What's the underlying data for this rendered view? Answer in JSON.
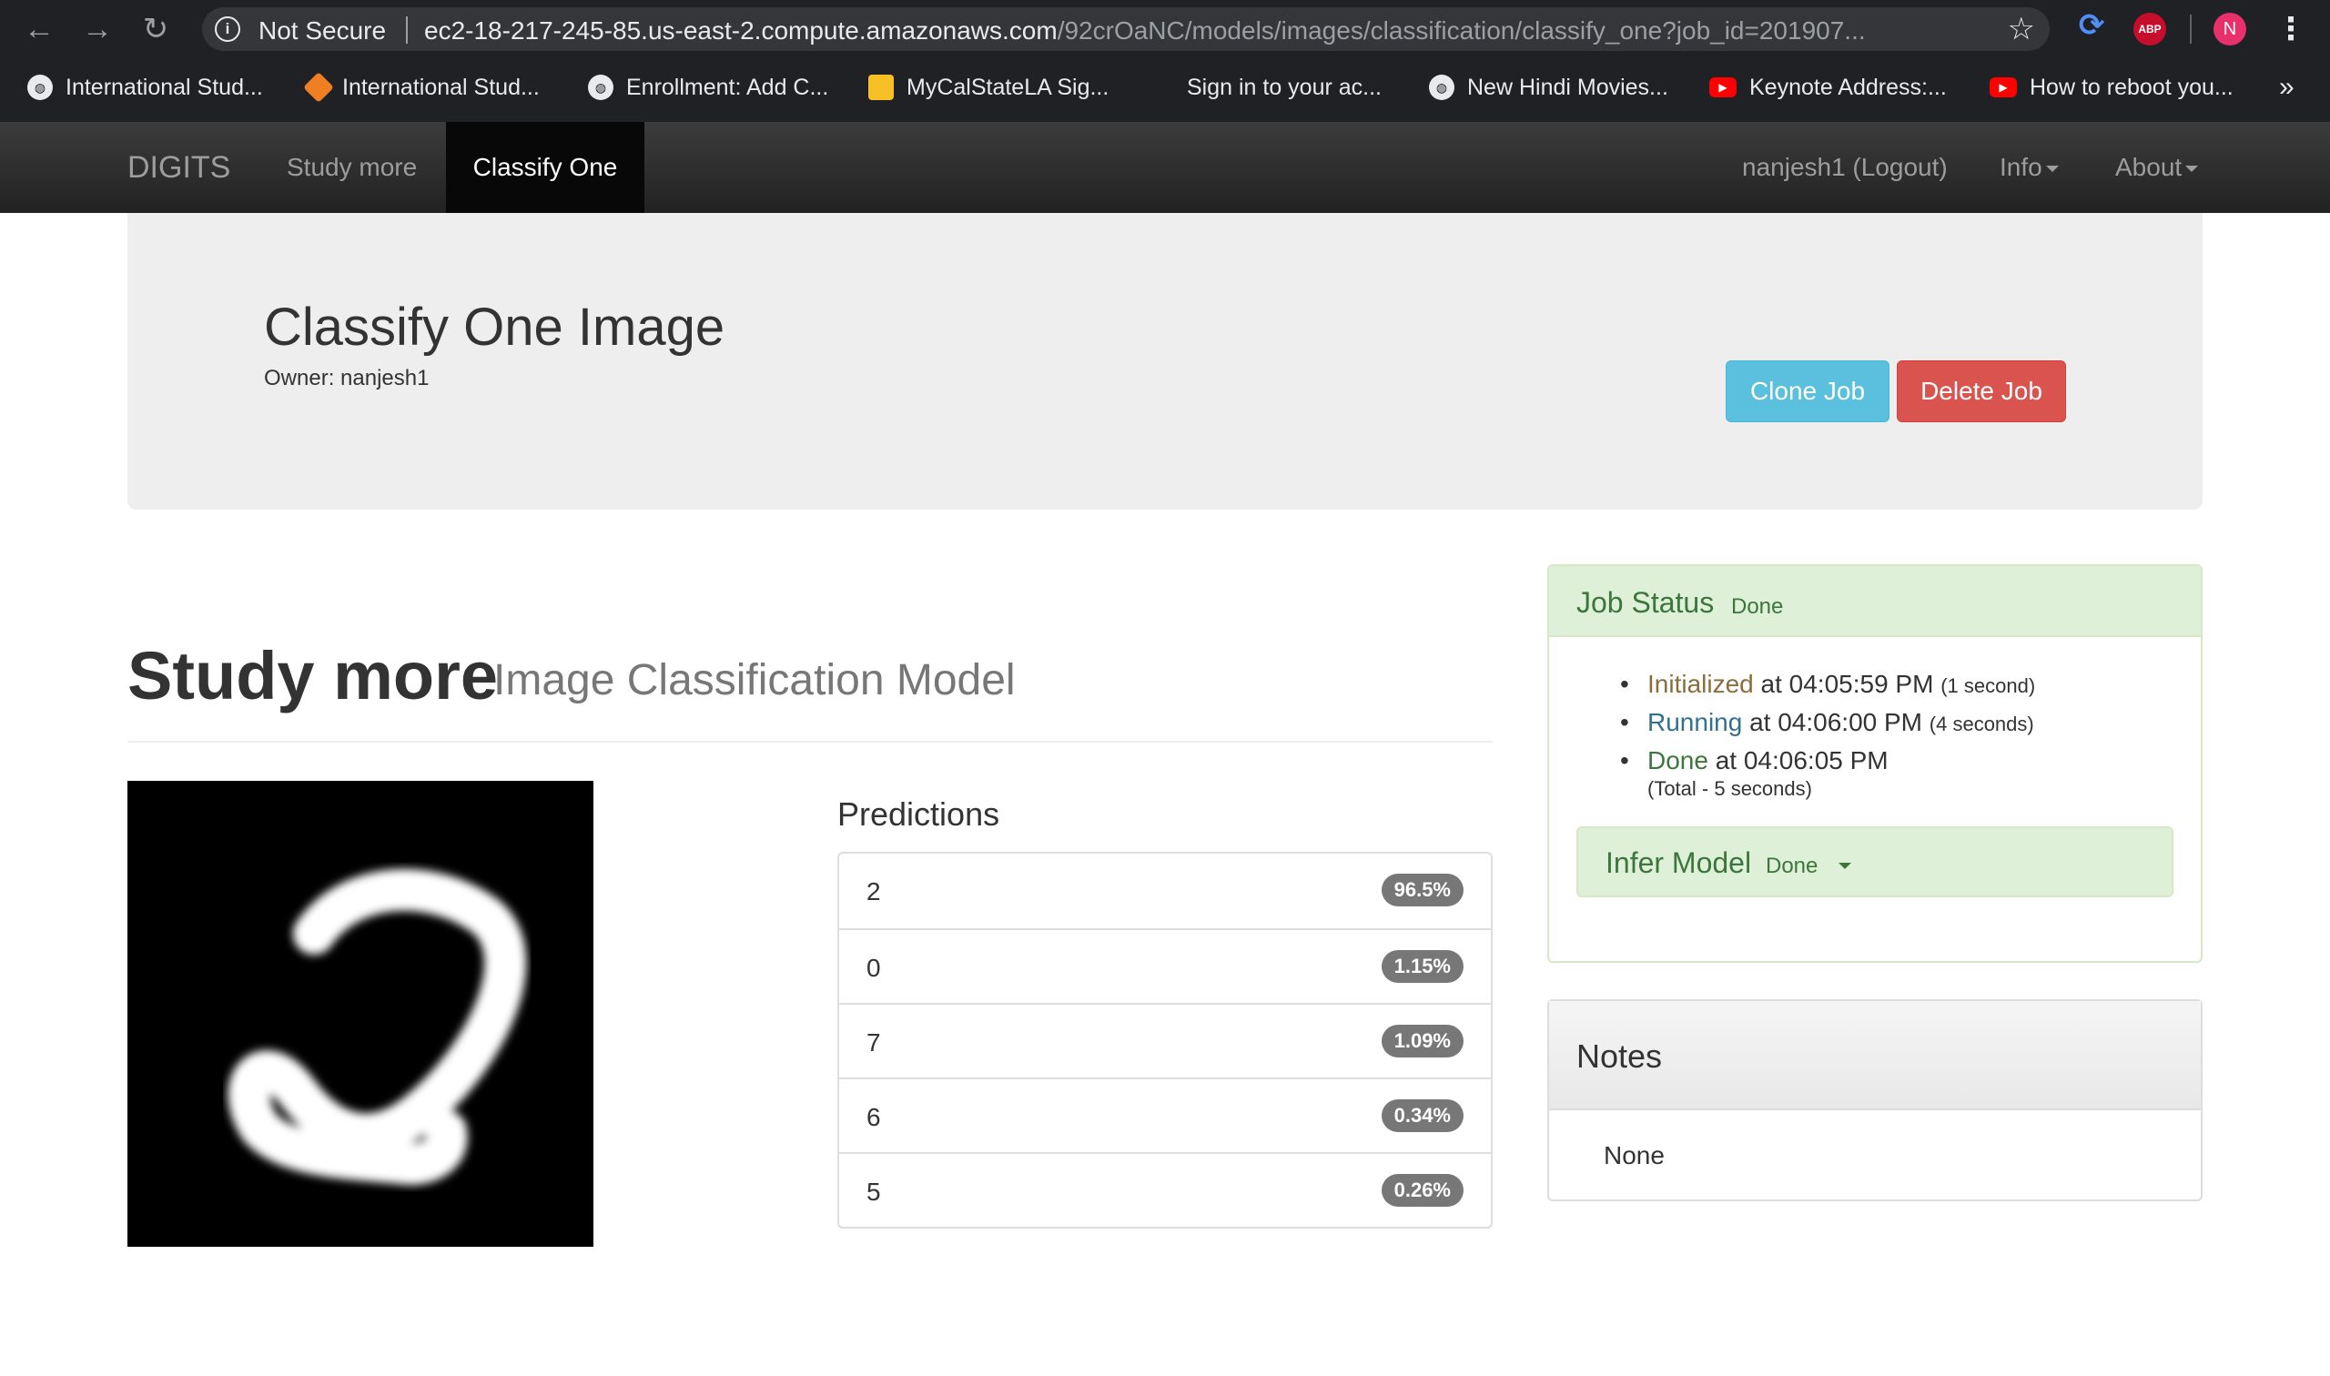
{
  "browser": {
    "security_label": "Not Secure",
    "url_host": "ec2-18-217-245-85.us-east-2.compute.amazonaws.com",
    "url_path": "/92crOaNC/models/images/classification/classify_one?job_id=201907...",
    "profile_initial": "N",
    "abp_label": "ABP",
    "more_bookmarks": "»",
    "bookmarks": [
      {
        "label": "International Stud...",
        "icon": "globe-icon"
      },
      {
        "label": "International Stud...",
        "icon": "orange-diamond-icon"
      },
      {
        "label": "Enrollment: Add C...",
        "icon": "globe-icon"
      },
      {
        "label": "MyCalStateLA Sig...",
        "icon": "yellow-shield-icon"
      },
      {
        "label": "Sign in to your ac...",
        "icon": "microsoft-icon"
      },
      {
        "label": "New Hindi Movies...",
        "icon": "globe-icon"
      },
      {
        "label": "Keynote Address:...",
        "icon": "youtube-icon"
      },
      {
        "label": "How to reboot you...",
        "icon": "youtube-icon"
      }
    ]
  },
  "navbar": {
    "brand": "DIGITS",
    "study_more": "Study more",
    "classify_one": "Classify One",
    "user": "nanjesh1 (Logout)",
    "info": "Info",
    "about": "About"
  },
  "job": {
    "title": "Classify One Image",
    "owner": "Owner: nanjesh1",
    "clone_label": "Clone Job",
    "delete_label": "Delete Job"
  },
  "model": {
    "name": "Study more",
    "type": "Image Classification Model"
  },
  "predictions": {
    "title": "Predictions",
    "items": [
      {
        "label": "2",
        "value": "96.5%"
      },
      {
        "label": "0",
        "value": "1.15%"
      },
      {
        "label": "7",
        "value": "1.09%"
      },
      {
        "label": "6",
        "value": "0.34%"
      },
      {
        "label": "5",
        "value": "0.26%"
      }
    ]
  },
  "status": {
    "title": "Job Status",
    "state": "Done",
    "events": [
      {
        "name": "Initialized",
        "time": "at 04:05:59 PM",
        "duration": "(1 second)"
      },
      {
        "name": "Running",
        "time": "at 04:06:00 PM",
        "duration": "(4 seconds)"
      },
      {
        "name": "Done",
        "time": "at 04:06:05 PM",
        "duration": ""
      }
    ],
    "total": "(Total - 5 seconds)",
    "infer_label": "Infer Model",
    "infer_state": "Done"
  },
  "notes": {
    "title": "Notes",
    "body": "None"
  },
  "colors": {
    "success_text": "#3c763d",
    "success_bg": "#dff0d8",
    "info_button": "#5bc0de",
    "danger_button": "#d9534f",
    "navbar_dark": "#222222"
  }
}
